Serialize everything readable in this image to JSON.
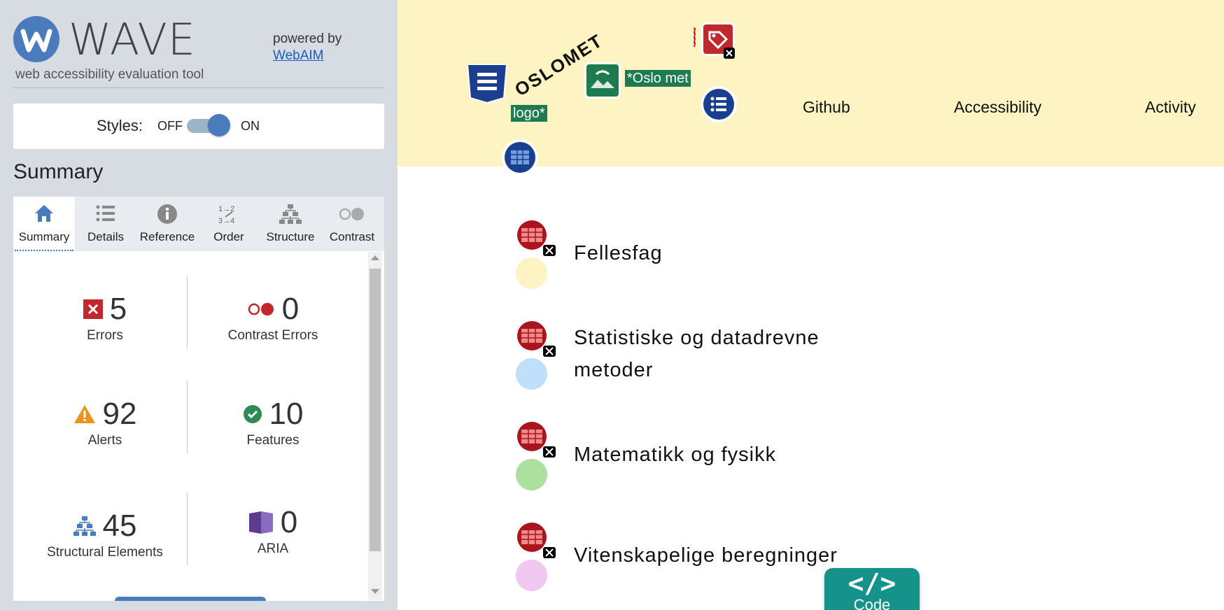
{
  "app": {
    "name": "WAVE",
    "subtitle": "web accessibility evaluation tool",
    "powered_by": "powered by",
    "powered_link": "WebAIM"
  },
  "styles_toggle": {
    "label": "Styles:",
    "off": "OFF",
    "on": "ON",
    "state": "on"
  },
  "summary_heading": "Summary",
  "tabs": [
    {
      "label": "Summary",
      "icon": "home-icon",
      "active": true
    },
    {
      "label": "Details",
      "icon": "list-icon",
      "active": false
    },
    {
      "label": "Reference",
      "icon": "info-icon",
      "active": false
    },
    {
      "label": "Order",
      "icon": "order-icon",
      "active": false
    },
    {
      "label": "Structure",
      "icon": "structure-icon",
      "active": false
    },
    {
      "label": "Contrast",
      "icon": "contrast-icon",
      "active": false
    }
  ],
  "stats": {
    "errors": {
      "value": "5",
      "label": "Errors",
      "color": "#c0282d"
    },
    "contrast_errors": {
      "value": "0",
      "label": "Contrast Errors",
      "color": "#c0282d"
    },
    "alerts": {
      "value": "92",
      "label": "Alerts",
      "color": "#e8951a"
    },
    "features": {
      "value": "10",
      "label": "Features",
      "color": "#2e8a57"
    },
    "structural": {
      "value": "45",
      "label": "Structural Elements",
      "color": "#4a7bbd"
    },
    "aria": {
      "value": "0",
      "label": "ARIA",
      "color": "#5d3c8e"
    }
  },
  "page": {
    "logo_text": "OSLOMET",
    "alt_tag_1": "*Oslo met",
    "alt_tag_2": "logo*",
    "nav": [
      "Github",
      "Accessibility",
      "Activity"
    ],
    "courses": [
      {
        "title_lines": [
          "Fellesfag"
        ],
        "color": "#fdf3c3"
      },
      {
        "title_lines": [
          "Statistiske og datadrevne",
          "metoder"
        ],
        "color": "#bfe0fb"
      },
      {
        "title_lines": [
          "Matematikk og fysikk"
        ],
        "color": "#abe09f"
      },
      {
        "title_lines": [
          "Vitenskapelige beregninger"
        ],
        "color": "#f1c8f0"
      }
    ],
    "code_button": {
      "glyph": "</>",
      "label": "Code"
    }
  }
}
